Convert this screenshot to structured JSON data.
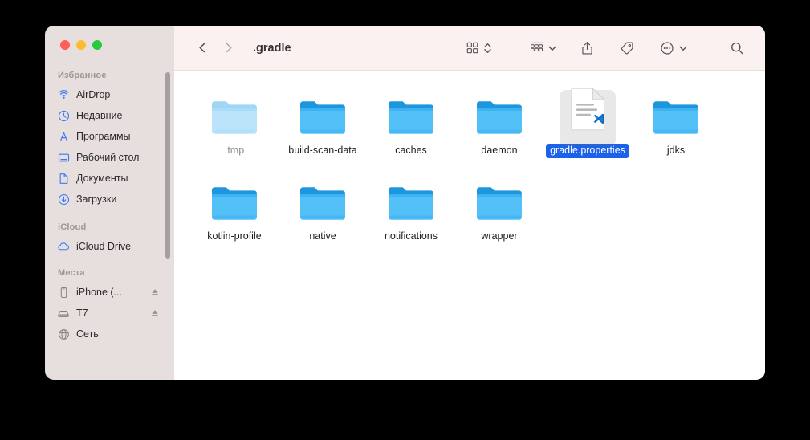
{
  "window": {
    "traffic_lights": [
      {
        "name": "close",
        "color": "#ff5f57"
      },
      {
        "name": "minimize",
        "color": "#febc2e"
      },
      {
        "name": "zoom",
        "color": "#28c840"
      }
    ]
  },
  "toolbar": {
    "back_label": "‹",
    "forward_label": "›",
    "path_title": ".gradle",
    "icons": [
      "icon-view-icon",
      "view-stepper-chevron-icon",
      "group-by-icon",
      "group-by-chevron-icon",
      "share-icon",
      "tag-icon",
      "more-actions-icon",
      "more-actions-chevron-icon",
      "search-icon"
    ]
  },
  "sidebar": {
    "groups": [
      {
        "title": "Избранное",
        "items": [
          {
            "label": "AirDrop",
            "icon": "airdrop-icon",
            "eject": false
          },
          {
            "label": "Недавние",
            "icon": "clock-icon",
            "eject": false
          },
          {
            "label": "Программы",
            "icon": "applications-icon",
            "eject": false
          },
          {
            "label": "Рабочий стол",
            "icon": "desktop-icon",
            "eject": false
          },
          {
            "label": "Документы",
            "icon": "document-icon",
            "eject": false
          },
          {
            "label": "Загрузки",
            "icon": "downloads-icon",
            "eject": false
          }
        ]
      },
      {
        "title": "iCloud",
        "items": [
          {
            "label": "iCloud Drive",
            "icon": "cloud-icon",
            "eject": false
          }
        ]
      },
      {
        "title": "Места",
        "items": [
          {
            "label": "iPhone (...",
            "icon": "iphone-icon",
            "eject": true
          },
          {
            "label": "T7",
            "icon": "external-drive-icon",
            "eject": true
          },
          {
            "label": "Сеть",
            "icon": "network-globe-icon",
            "eject": false
          }
        ]
      }
    ]
  },
  "files": {
    "rows": [
      [
        {
          "name": ".tmp",
          "type": "folder",
          "state": "dimmed",
          "selected": false
        },
        {
          "name": "build-scan-data",
          "type": "folder",
          "state": "normal",
          "selected": false
        },
        {
          "name": "caches",
          "type": "folder",
          "state": "normal",
          "selected": false
        },
        {
          "name": "daemon",
          "type": "folder",
          "state": "normal",
          "selected": false
        },
        {
          "name": "gradle.properties",
          "type": "file-vscode",
          "state": "normal",
          "selected": true
        },
        {
          "name": "jdks",
          "type": "folder",
          "state": "normal",
          "selected": false
        }
      ],
      [
        {
          "name": "kotlin-profile",
          "type": "folder",
          "state": "normal",
          "selected": false
        },
        {
          "name": "native",
          "type": "folder",
          "state": "normal",
          "selected": false
        },
        {
          "name": "notifications",
          "type": "folder",
          "state": "normal",
          "selected": false
        },
        {
          "name": "wrapper",
          "type": "folder",
          "state": "normal",
          "selected": false
        }
      ]
    ]
  },
  "colors": {
    "selection_blue": "#1b62e8",
    "folder_blue": "#54c0f8",
    "folder_tab_blue": "#1e96dd",
    "sidebar_bg": "#e7dede",
    "toolbar_bg": "#fbf1f1",
    "accent_icon_blue": "#3a7bfa"
  }
}
